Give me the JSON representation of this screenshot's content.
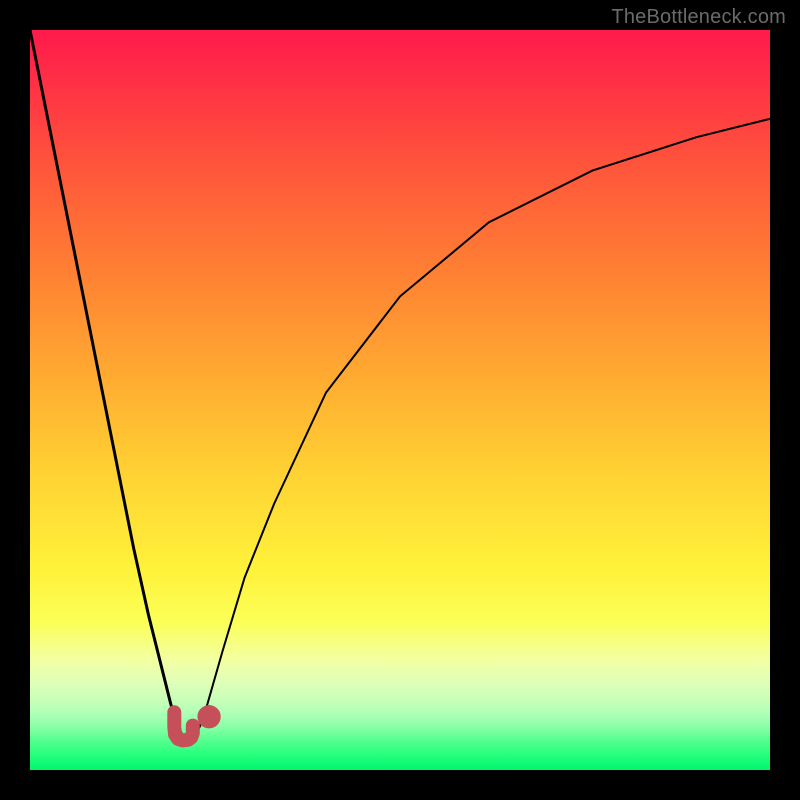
{
  "watermark": "TheBottleneck.com",
  "colors": {
    "frame": "#000000",
    "curve": "#000000",
    "marker": "#c5505a",
    "gradient_top": "#ff1a4c",
    "gradient_bottom": "#00f56e"
  },
  "chart_data": {
    "type": "line",
    "title": "",
    "xlabel": "",
    "ylabel": "",
    "xlim": [
      0,
      100
    ],
    "ylim": [
      0,
      100
    ],
    "legend": false,
    "grid": false,
    "annotations": [],
    "series": [
      {
        "name": "left-curve",
        "x": [
          0,
          4,
          8,
          12,
          14,
          16,
          18,
          19,
          19.8,
          20.5,
          21.2,
          22
        ],
        "values": [
          100,
          80,
          60,
          40,
          30,
          21,
          13,
          9,
          6.2,
          4.8,
          4.2,
          4
        ]
      },
      {
        "name": "right-curve",
        "x": [
          22,
          23,
          24,
          26,
          29,
          33,
          40,
          50,
          62,
          76,
          90,
          100
        ],
        "values": [
          4,
          6,
          9,
          16,
          26,
          36,
          51,
          64,
          74,
          81,
          85.5,
          88
        ]
      },
      {
        "name": "marker-u-shape",
        "x": [
          19.5,
          19.5,
          19.6,
          20.0,
          20.6,
          21.4,
          21.8,
          22.0,
          22.0
        ],
        "values": [
          7.8,
          5.8,
          4.8,
          4.2,
          4.0,
          4.1,
          4.4,
          5.0,
          6.0
        ]
      }
    ],
    "markers": [
      {
        "name": "dot-right",
        "x": 24.2,
        "y": 7.2,
        "r": 1.0,
        "color": "#c5505a"
      }
    ]
  }
}
